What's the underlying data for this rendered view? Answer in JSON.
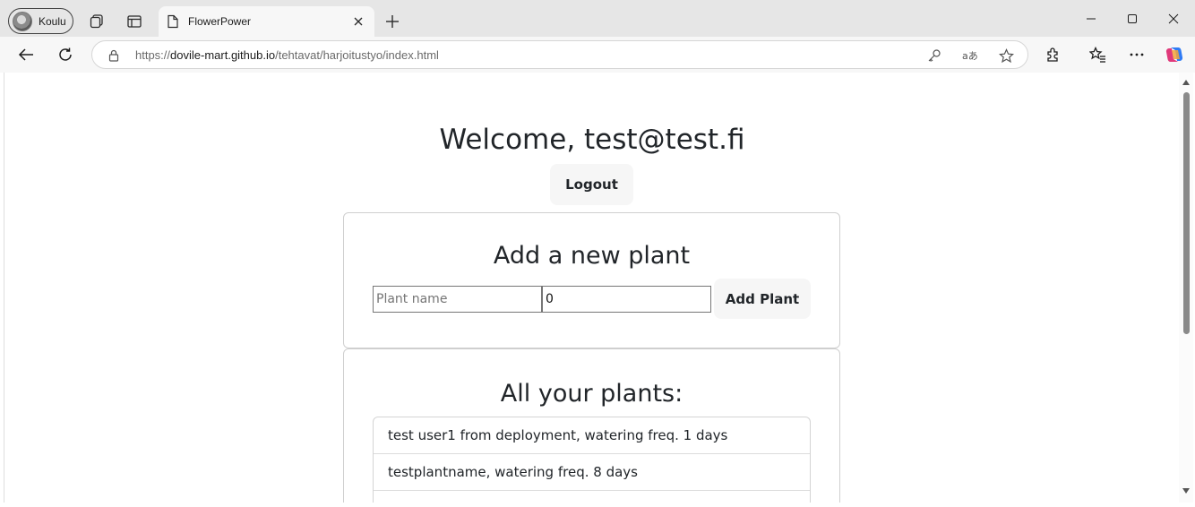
{
  "browser": {
    "profile_label": "Koulu",
    "tab_title": "FlowerPower",
    "url_prefix": "https://",
    "url_host": "dovile-mart.github.io",
    "url_path": "/tehtavat/harjoitustyo/index.html"
  },
  "page": {
    "welcome": "Welcome, test@test.fi",
    "logout_label": "Logout",
    "add_title": "Add a new plant",
    "name_placeholder": "Plant name",
    "freq_value": "0",
    "add_label": "Add Plant",
    "list_title": "All your plants:",
    "plants": [
      "test user1 from deployment, watering freq. 1 days",
      "testplantname, watering freq. 8 days",
      ""
    ]
  }
}
